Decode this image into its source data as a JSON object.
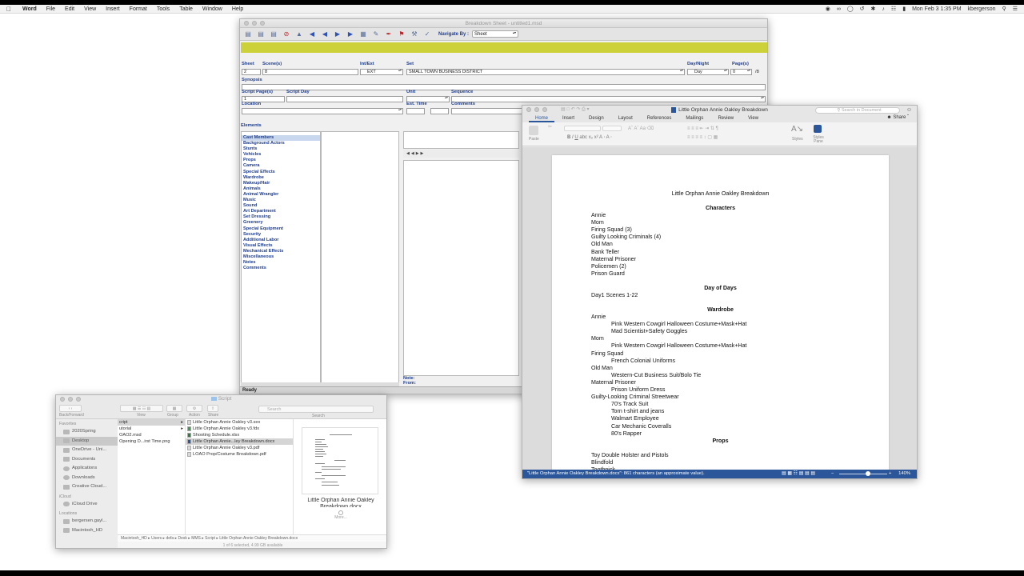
{
  "menubar": {
    "app": "Word",
    "menus": [
      "File",
      "Edit",
      "View",
      "Insert",
      "Format",
      "Tools",
      "Table",
      "Window",
      "Help"
    ],
    "clock": "Mon Feb 3  1:35 PM",
    "user": "kbergerson"
  },
  "breakdown": {
    "title": "Breakdown Sheet - untitled1.msd",
    "navigate_label": "Navigate By :",
    "navigate_value": "Sheet",
    "labels": {
      "sheet": "Sheet",
      "scenes": "Scene(s)",
      "intext": "Int/Ext",
      "set": "Set",
      "daynight": "Day/Night",
      "pages": "Page(s)",
      "synopsis": "Synopsis",
      "script_pages": "Script Page(s)",
      "script_day": "Script Day",
      "unit": "Unit",
      "sequence": "Sequence",
      "location": "Location",
      "est_time": "Est. Time",
      "comments": "Comments",
      "elements": "Elements",
      "note": "Note:",
      "from": "From:"
    },
    "values": {
      "sheet": "2",
      "scenes": "8",
      "intext": "EXT",
      "set": "SMALL TOWN BUSINESS DISTRICT",
      "daynight": "Day",
      "pages": "0",
      "pages_suffix": "/8",
      "script_pages": "1"
    },
    "elements": [
      "Cast Members",
      "Background Actors",
      "Stunts",
      "Vehicles",
      "Props",
      "Camera",
      "Special Effects",
      "Wardrobe",
      "Makeup/Hair",
      "Animals",
      "Animal Wrangler",
      "Music",
      "Sound",
      "Art Department",
      "Set Dressing",
      "Greenery",
      "Special Equipment",
      "Security",
      "Additional Labor",
      "Visual Effects",
      "Mechanical Effects",
      "Miscellaneous",
      "Notes",
      "Comments"
    ],
    "status": "Ready"
  },
  "finder": {
    "title": "Script",
    "toolbar": {
      "backforward": "Back/Forward",
      "view": "View",
      "group": "Group",
      "action": "Action",
      "share": "Share",
      "search_label": "Search",
      "search_placeholder": "Search"
    },
    "sidebar": {
      "favorites_header": "Favorites",
      "favorites": [
        "2020Spring",
        "Desktop",
        "OneDrive - Uni...",
        "Documents",
        "Applications",
        "Downloads",
        "Creative Cloud..."
      ],
      "icloud_header": "iCloud",
      "icloud": [
        "iCloud Drive"
      ],
      "locations_header": "Locations",
      "locations": [
        "bergersen.gayl...",
        "Macintosh_HD"
      ]
    },
    "column1": [
      "cript",
      "utorial",
      "OAO2.msd",
      "Opening D...irst Time.png"
    ],
    "column2": [
      "Little Orphan Annie Oakley v3.sex",
      "Little Orphan Annie Oakley v3.fdx",
      "Shooting Schedule.xlsx",
      "Little Orphan Annie...ley Breakdown.docx",
      "Little Orphan Annie Oakley v3.pdf",
      "LOAO Prop/Costume Breakdown.pdf"
    ],
    "preview_name": "Little Orphan Annie Oakley Breakdown.docx",
    "preview_more": "More...",
    "path": [
      "Macintosh_HD",
      "Users",
      "defa",
      "Desk",
      "MMS",
      "Script",
      "Little Orphan Annie Oakley Breakdown.docx"
    ],
    "status": "1 of 6 selected, 4.99 GB available"
  },
  "word": {
    "title": "Little Orphan Annie Oakley Breakdown",
    "search_placeholder": "Search in Document",
    "tabs": [
      "Home",
      "Insert",
      "Design",
      "Layout",
      "References",
      "Mailings",
      "Review",
      "View"
    ],
    "share": "Share",
    "ribbon": {
      "paste": "Paste",
      "styles": "Styles",
      "styles_pane": "Styles Pane"
    },
    "doc_title": "Little Orphan Annie Oakley Breakdown",
    "characters_heading": "Characters",
    "characters": [
      "Annie",
      "Mom",
      "Firing Squad (3)",
      "Guilty Looking Criminals (4)",
      "Old Man",
      "Bank Teller",
      "Maternal Prisoner",
      "Policemen (2)",
      "Prison Guard"
    ],
    "days_heading": "Day of Days",
    "days": [
      "Day1 Scenes 1-22"
    ],
    "wardrobe_heading": "Wardrobe",
    "wardrobe": [
      {
        "name": "Annie",
        "items": [
          "Pink Western Cowgirl Halloween Costume+Mask+Hat",
          "Mad Scientist+Safety Goggles"
        ]
      },
      {
        "name": "Mom",
        "items": [
          "Pink Western Cowgirl Halloween Costume+Mask+Hat"
        ]
      },
      {
        "name": "Firing Squad",
        "items": [
          "French Colonial Uniforms"
        ]
      },
      {
        "name": "Old Man",
        "items": [
          "Western-Cut Business Suit/Bolo Tie"
        ]
      },
      {
        "name": "Maternal Prisoner",
        "items": [
          "Prison Uniform Dress"
        ]
      },
      {
        "name": "Guilty-Looking Criminal Streetwear",
        "items": [
          "70's Track Suit",
          "Torn t-shirt and jeans",
          "Walmart Employee",
          "Car Mechanic Coveralls",
          "80's Rapper"
        ]
      }
    ],
    "props_heading": "Props",
    "props": [
      "Toy Double Holster and Pistols",
      "Blindfold",
      "Toothpick"
    ],
    "status": "\"Little Orphan Annie Oakley Breakdown.docx\": 861 characters (an approximate value).",
    "zoom": "140%"
  }
}
